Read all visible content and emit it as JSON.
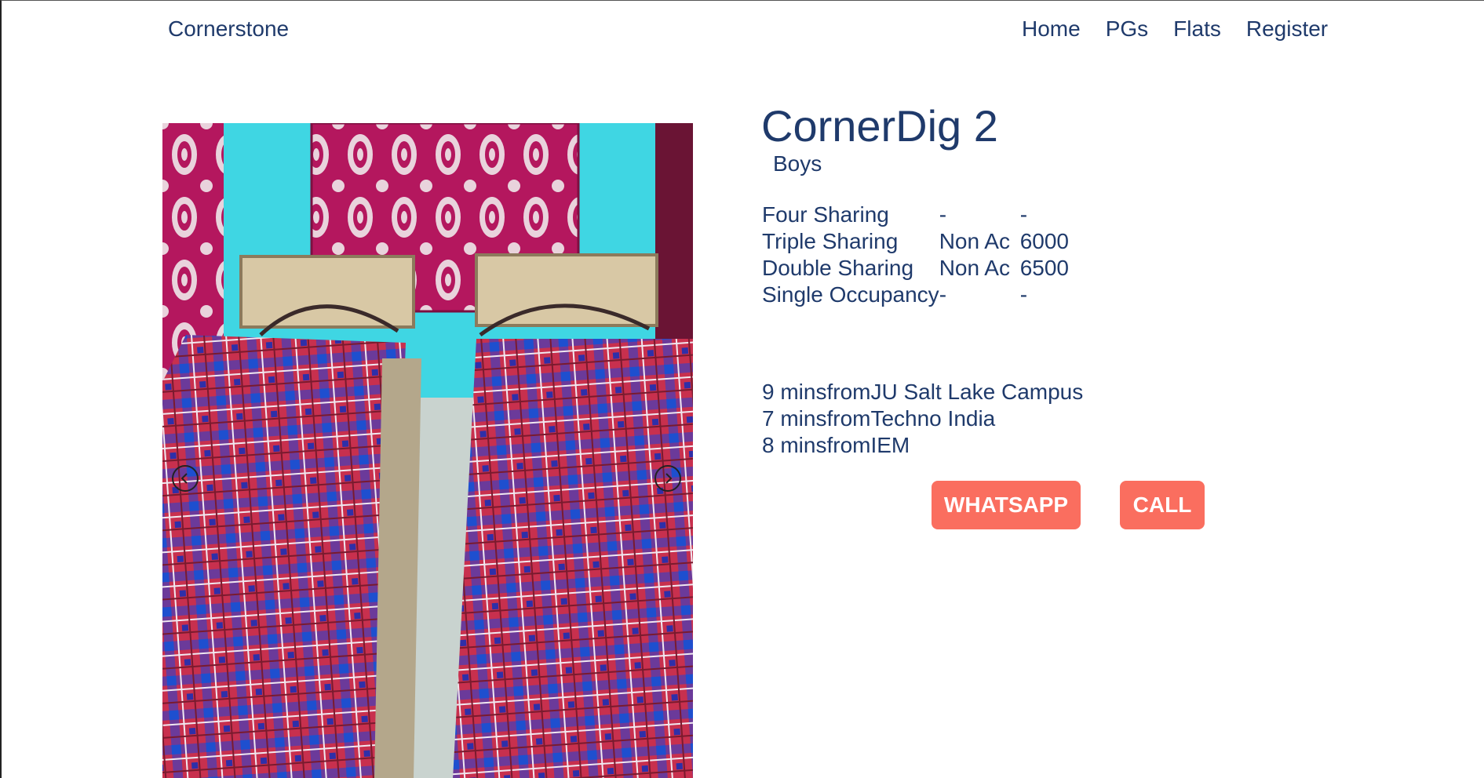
{
  "navbar": {
    "brand": "Cornerstone",
    "links": [
      "Home",
      "PGs",
      "Flats",
      "Register"
    ]
  },
  "carousel": {
    "image_alt": "Room photo with two beds",
    "prev_icon": "chevron-left-icon",
    "next_icon": "chevron-right-icon"
  },
  "listing": {
    "name": "CornerDig 2",
    "gender": "Boys",
    "pricing": [
      {
        "type": "Four Sharing",
        "ac": "-",
        "price": "-"
      },
      {
        "type": "Triple Sharing",
        "ac": "Non Ac",
        "price": "6000"
      },
      {
        "type": "Double Sharing",
        "ac": "Non Ac",
        "price": "6500"
      },
      {
        "type": "Single Occupancy",
        "ac": "-",
        "price": "-"
      }
    ],
    "distances": [
      {
        "time": "9 mins",
        "sep": "from",
        "place": "JU Salt Lake Campus"
      },
      {
        "time": "7 mins",
        "sep": "from",
        "place": "Techno India"
      },
      {
        "time": "8 mins",
        "sep": "from",
        "place": "IEM"
      }
    ]
  },
  "actions": {
    "whatsapp_label": "WHATSAPP",
    "call_label": "CALL"
  },
  "colors": {
    "text": "#1f3a6b",
    "button": "#fa6e5f",
    "button_text": "#ffffff"
  }
}
